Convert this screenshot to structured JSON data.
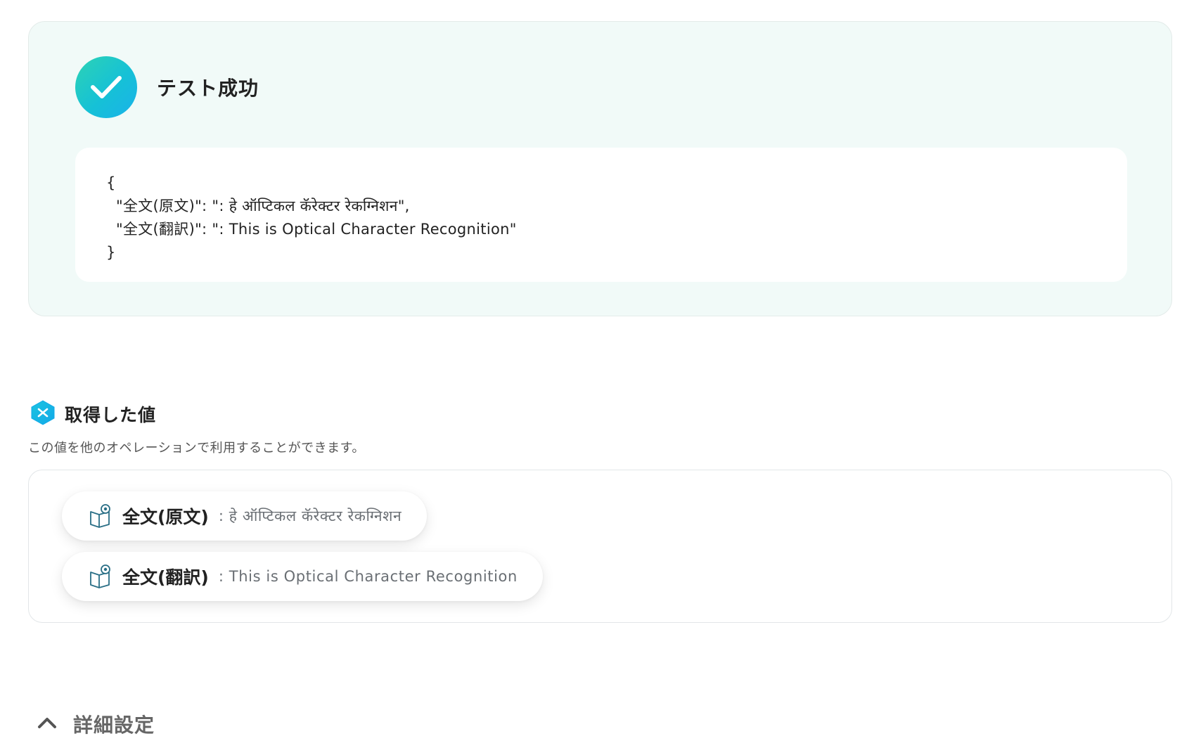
{
  "success": {
    "title": "テスト成功",
    "icon": "check-circle-icon",
    "code_lines": [
      "{",
      "  \"全文(原文)\": \": हे ऑप्टिकल कॅरेक्टर रेकग्निशन\",",
      "  \"全文(翻訳)\": \": This is Optical Character Recognition\"",
      "}"
    ]
  },
  "values": {
    "title": "取得した値",
    "icon": "variable-hexagon-icon",
    "description": "この値を他のオペレーションで利用することができます。",
    "items": [
      {
        "key": "全文(原文)",
        "value": ": हे ऑप्टिकल कॅरेक्टर रेकग्निशन",
        "icon": "book-eye-icon"
      },
      {
        "key": "全文(翻訳)",
        "value": ": This is Optical Character Recognition",
        "icon": "book-eye-icon"
      }
    ]
  },
  "advanced": {
    "label": "詳細設定",
    "icon": "chevron-up-icon"
  },
  "colors": {
    "panel_bg": "#f1faf8",
    "accent_start": "#2dd3b4",
    "accent_end": "#1ab2ea",
    "chip_icon": "#2a6f86"
  }
}
